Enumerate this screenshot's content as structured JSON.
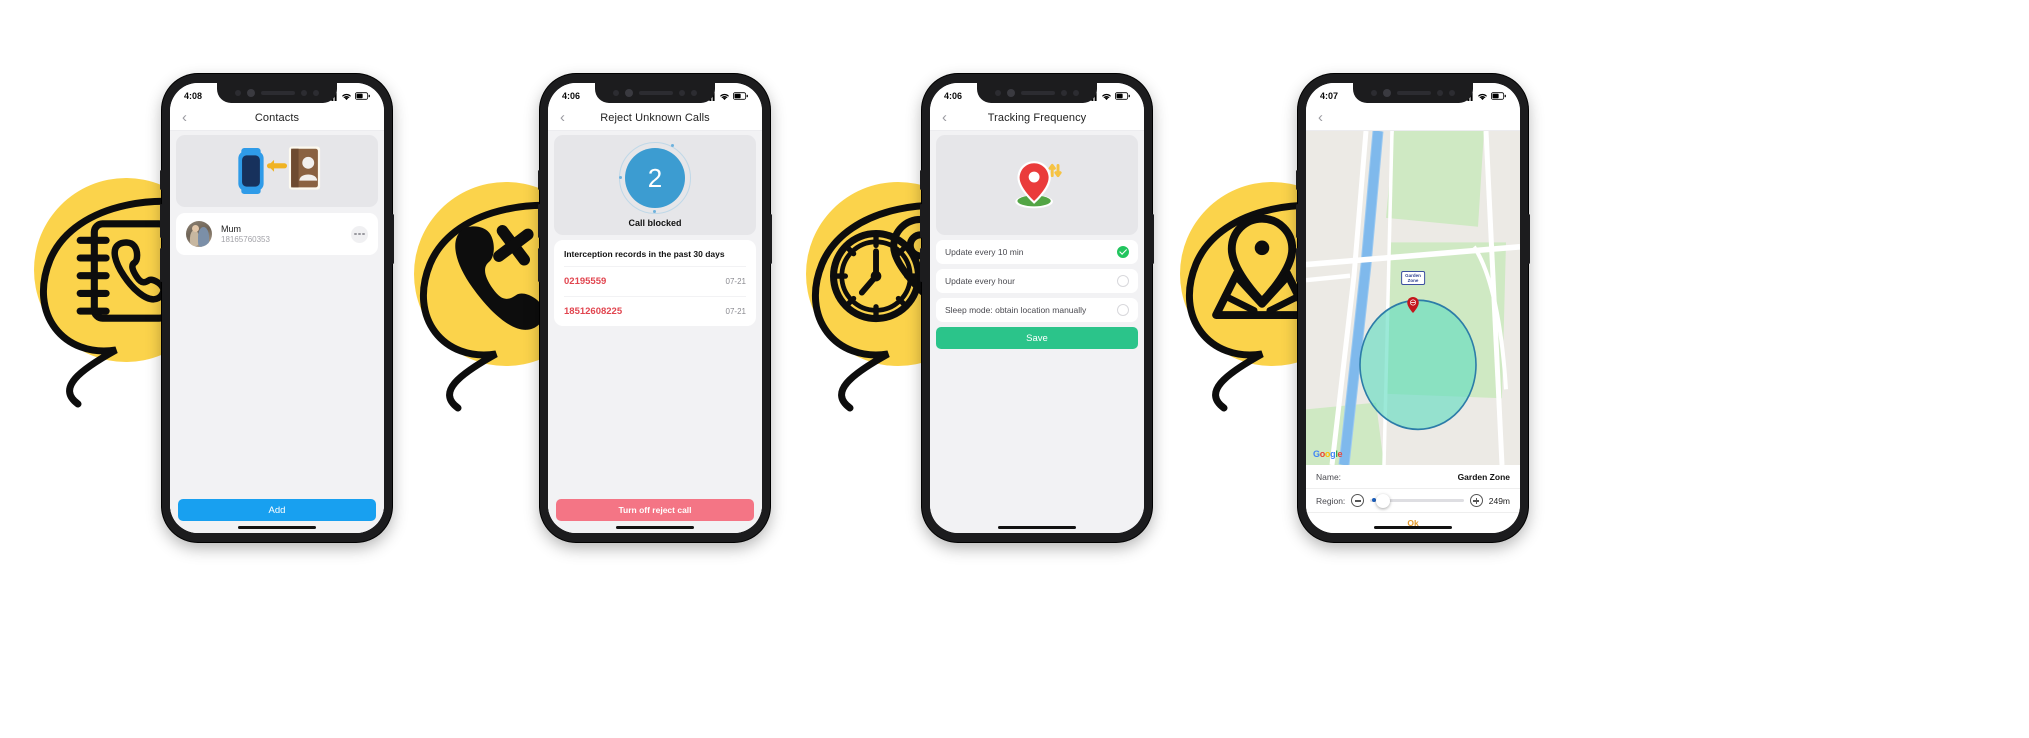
{
  "phones": [
    {
      "id": "contacts",
      "status": {
        "time": "4:08",
        "signal": "cellular-bars-icon",
        "wifi": "wifi-icon",
        "battery": "battery-icon"
      },
      "nav": {
        "back": "‹",
        "title": "Contacts"
      },
      "hero": {
        "icon": "watch-to-contactbook-sync-illustration"
      },
      "contacts": [
        {
          "name": "Mum",
          "number": "18165760353",
          "more": "more-options-icon"
        }
      ],
      "cta": {
        "label": "Add",
        "color": "#18A0F0"
      }
    },
    {
      "id": "reject-unknown-calls",
      "status": {
        "time": "4:06",
        "signal": "cellular-bars-icon",
        "wifi": "wifi-icon",
        "battery": "battery-icon"
      },
      "nav": {
        "back": "‹",
        "title": "Reject Unknown Calls"
      },
      "hero": {
        "count": "2",
        "caption": "Call blocked",
        "circle_color": "#3C9CD1"
      },
      "records": {
        "title": "Interception records in the past 30 days",
        "rows": [
          {
            "number": "02195559",
            "date": "07-21"
          },
          {
            "number": "18512608225",
            "date": "07-21"
          }
        ]
      },
      "cta": {
        "label": "Turn off reject call",
        "color": "#F47585"
      }
    },
    {
      "id": "tracking-frequency",
      "status": {
        "time": "4:06",
        "signal": "cellular-bars-icon",
        "wifi": "wifi-icon",
        "battery": "battery-icon"
      },
      "nav": {
        "back": "‹",
        "title": "Tracking Frequency"
      },
      "hero": {
        "icon": "location-pin-refresh-illustration"
      },
      "options": [
        {
          "label": "Update every 10 min",
          "selected": true
        },
        {
          "label": "Update every hour",
          "selected": false
        },
        {
          "label": "Sleep mode: obtain location manually",
          "selected": false
        }
      ],
      "cta": {
        "label": "Save",
        "color": "#2BC48A"
      }
    },
    {
      "id": "geofence-map",
      "status": {
        "time": "4:07",
        "signal": "cellular-bars-icon",
        "wifi": "wifi-icon",
        "battery": "battery-icon"
      },
      "nav": {
        "back": "‹",
        "title": ""
      },
      "map": {
        "watermark": "Google",
        "pin_label": "Garden\nZone",
        "zone_fill": "#6fe0c0"
      },
      "fields": [
        {
          "label": "Name:",
          "value": "Garden Zone"
        },
        {
          "label": "Region:",
          "value": "249m",
          "minus": "minus-circle-icon",
          "plus": "plus-circle-icon"
        }
      ],
      "cta": {
        "label": "Ok",
        "color": "#E29A2C"
      }
    }
  ],
  "bubbles": [
    {
      "icon": "phone-book-icon",
      "color": "#FBD34B"
    },
    {
      "icon": "phone-blocked-icon",
      "color": "#FBD34B"
    },
    {
      "icon": "clock-location-icon",
      "color": "#FBD34B"
    },
    {
      "icon": "map-pin-icon",
      "color": "#FBD34B"
    }
  ]
}
